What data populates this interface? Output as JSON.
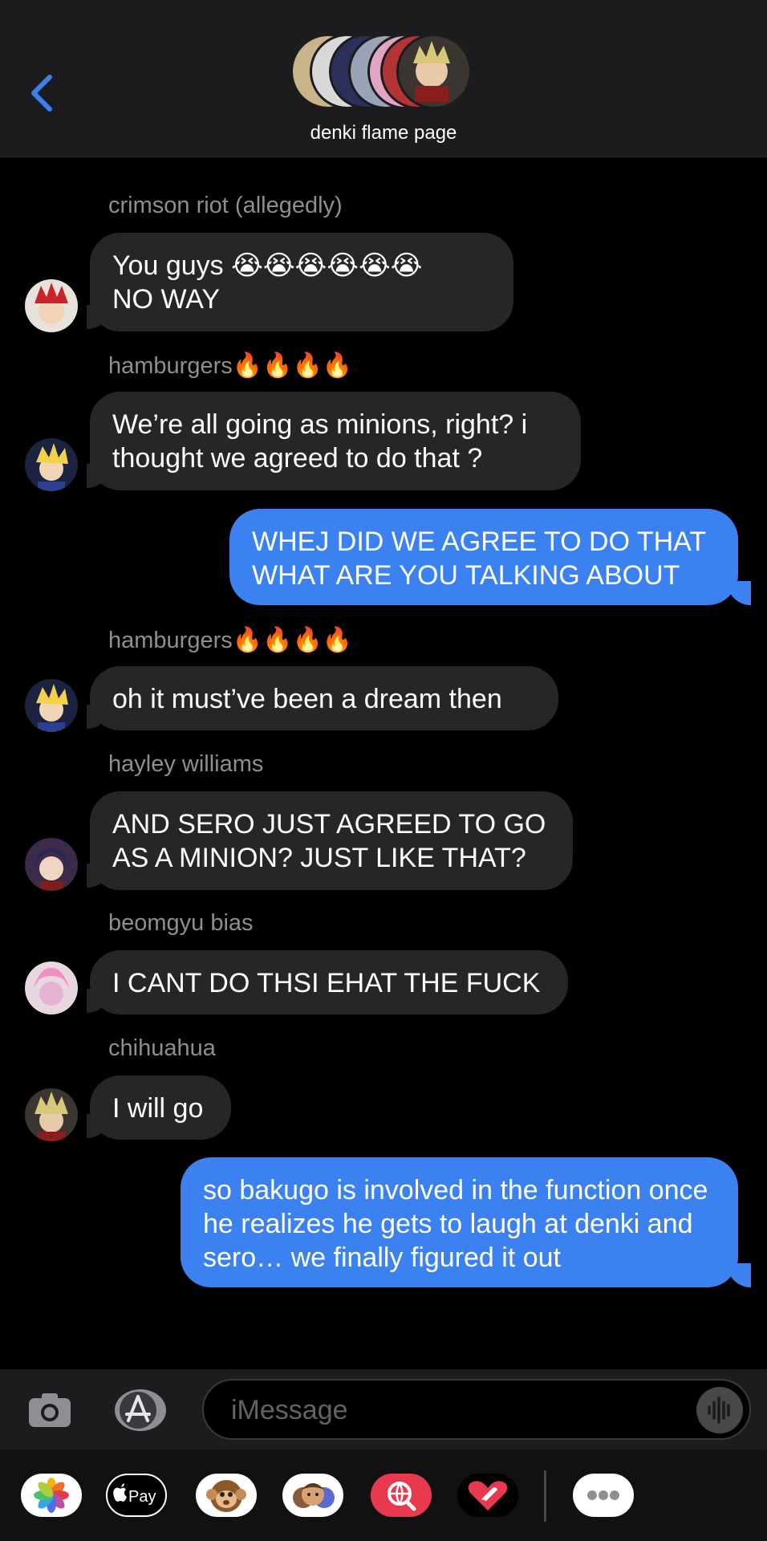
{
  "header": {
    "group_name": "denki flame page"
  },
  "messages": [
    {
      "sender": "crimson riot (allegedly)",
      "text": "You guys 😭😭😭😭😭😭\nNO WAY"
    },
    {
      "sender": "hamburgers",
      "sender_emoji": "🔥🔥🔥🔥",
      "text": "We’re all going as minions, right? i thought we agreed to do that ?"
    },
    {
      "text": "WHEJ DID WE AGREE TO DO THAT WHAT ARE YOU TALKING ABOUT"
    },
    {
      "sender": "hamburgers",
      "sender_emoji": "🔥🔥🔥🔥",
      "text": "oh it must’ve been a dream then"
    },
    {
      "sender": "hayley williams",
      "text": "AND SERO JUST AGREED TO GO AS A MINION? JUST LIKE THAT?"
    },
    {
      "sender": "beomgyu bias",
      "text": "I CANT DO THSI EHAT THE FUCK"
    },
    {
      "sender": "chihuahua",
      "text": "I will go"
    },
    {
      "text": "so bakugo is involved in the function once he realizes he gets to laugh at denki and sero… we finally figured it out"
    }
  ],
  "composer": {
    "placeholder": "iMessage"
  },
  "drawer": {
    "apple_pay_label": "Pay"
  },
  "colors": {
    "outgoing_bubble": "#3b82f0",
    "incoming_bubble": "#262628",
    "accent": "#3b82f0"
  }
}
